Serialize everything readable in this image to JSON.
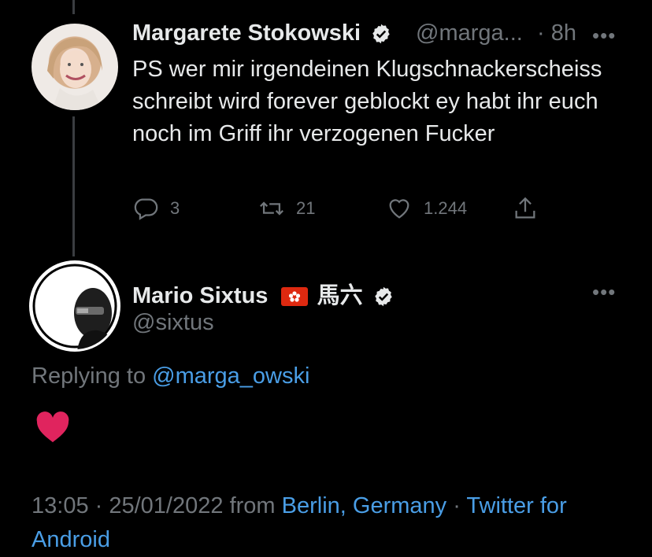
{
  "tweet1": {
    "display_name": "Margarete Stokowski",
    "handle": "@marga...",
    "time": "· 8h",
    "text": "PS wer mir irgendeinen Klugschnackerscheiss schreibt wird forever geblockt ey habt ihr euch noch im Griff ihr verzogenen Fucker",
    "replies": "3",
    "retweets": "21",
    "likes": "1.244"
  },
  "tweet2": {
    "display_name": "Mario Sixtus",
    "name_suffix": "馬六",
    "flag_icon": "hong-kong-flag-icon",
    "handle": "@sixtus",
    "replying_prefix": "Replying to",
    "replying_handle": "@marga_owski",
    "content": "❤️",
    "time": "13:05",
    "date": "25/01/2022",
    "from": "from",
    "location": "Berlin, Germany",
    "client": "Twitter for Android"
  },
  "colors": {
    "background": "#000000",
    "text": "#e7e9ea",
    "muted": "#71767b",
    "link": "#4a9ee6",
    "heart": "#e0245e"
  }
}
